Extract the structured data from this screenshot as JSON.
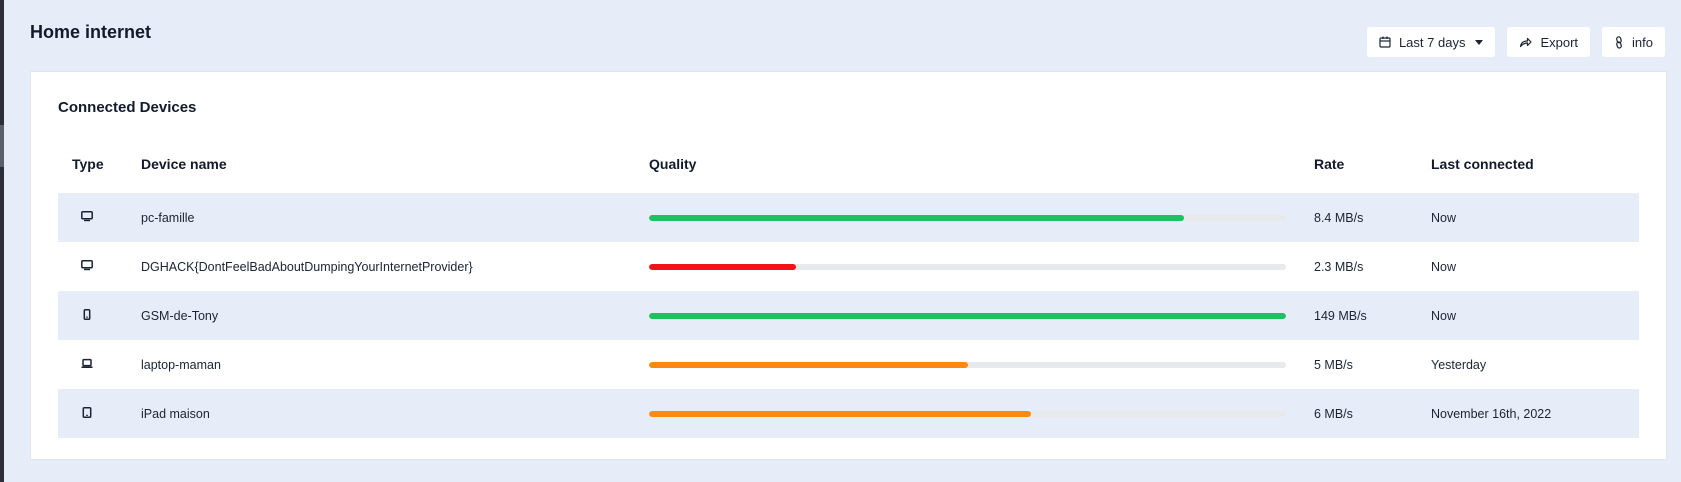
{
  "header": {
    "title": "Home internet"
  },
  "toolbar": {
    "range_label": "Last 7 days",
    "export_label": "Export",
    "info_label": "info"
  },
  "card": {
    "title": "Connected Devices"
  },
  "table": {
    "columns": [
      "Type",
      "Device name",
      "Quality",
      "Rate",
      "Last connected"
    ],
    "rows": [
      {
        "type_icon": "desktop-icon",
        "name": "pc-famille",
        "quality": 0.84,
        "quality_color": "#1ec15f",
        "rate": "8.4 MB/s",
        "last": "Now"
      },
      {
        "type_icon": "desktop-icon",
        "name": "DGHACK{DontFeelBadAboutDumpingYourInternetProvider}",
        "quality": 0.23,
        "quality_color": "#f2121b",
        "rate": "2.3 MB/s",
        "last": "Now"
      },
      {
        "type_icon": "phone-icon",
        "name": "GSM-de-Tony",
        "quality": 1.0,
        "quality_color": "#1ec15f",
        "rate": "149 MB/s",
        "last": "Now"
      },
      {
        "type_icon": "laptop-icon",
        "name": "laptop-maman",
        "quality": 0.5,
        "quality_color": "#fa8a12",
        "rate": "5 MB/s",
        "last": "Yesterday"
      },
      {
        "type_icon": "tablet-icon",
        "name": "iPad maison",
        "quality": 0.6,
        "quality_color": "#fa8a12",
        "rate": "6 MB/s",
        "last": "November 16th, 2022"
      }
    ]
  },
  "colors": {
    "page_bg": "#e6edf8",
    "good": "#1ec15f",
    "bad": "#f2121b",
    "medium": "#fa8a12"
  }
}
